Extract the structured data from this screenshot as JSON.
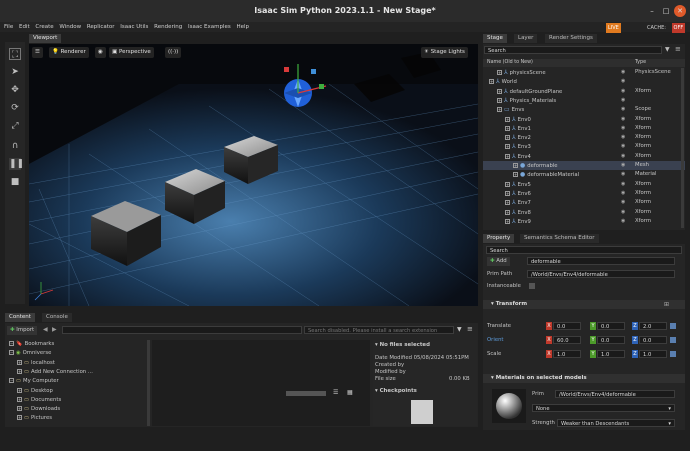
{
  "window": {
    "title": "Isaac Sim Python 2023.1.1 - New Stage*"
  },
  "menu": [
    "File",
    "Edit",
    "Create",
    "Window",
    "Replicator",
    "Isaac Utils",
    "Rendering",
    "Isaac Examples",
    "Help"
  ],
  "status": {
    "live": "LIVE",
    "cache_label": "CACHE:",
    "cache_state": "OFF"
  },
  "viewport": {
    "tab": "Viewport",
    "renderer": "Renderer",
    "camera": "Perspective",
    "stage_lights": "Stage Lights"
  },
  "stage": {
    "tabs": [
      "Stage",
      "Layer",
      "Render Settings"
    ],
    "search_placeholder": "Search",
    "col_name": "Name (Old to New)",
    "col_type": "Type",
    "rows": [
      {
        "name": "physicsScene",
        "type": "PhysicsScene",
        "indent": 1
      },
      {
        "name": "World",
        "type": "",
        "indent": 0
      },
      {
        "name": "defaultGroundPlane",
        "type": "Xform",
        "indent": 1
      },
      {
        "name": "Physics_Materials",
        "type": "",
        "indent": 1
      },
      {
        "name": "Envs",
        "type": "Scope",
        "indent": 1
      },
      {
        "name": "Env0",
        "type": "Xform",
        "indent": 2
      },
      {
        "name": "Env1",
        "type": "Xform",
        "indent": 2
      },
      {
        "name": "Env2",
        "type": "Xform",
        "indent": 2
      },
      {
        "name": "Env3",
        "type": "Xform",
        "indent": 2
      },
      {
        "name": "Env4",
        "type": "Xform",
        "indent": 2
      },
      {
        "name": "deformable",
        "type": "Mesh",
        "indent": 3
      },
      {
        "name": "deformableMaterial",
        "type": "Material",
        "indent": 3
      },
      {
        "name": "Env5",
        "type": "Xform",
        "indent": 2
      },
      {
        "name": "Env6",
        "type": "Xform",
        "indent": 2
      },
      {
        "name": "Env7",
        "type": "Xform",
        "indent": 2
      },
      {
        "name": "Env8",
        "type": "Xform",
        "indent": 2
      },
      {
        "name": "Env9",
        "type": "Xform",
        "indent": 2
      }
    ]
  },
  "property": {
    "tabs": [
      "Property",
      "Semantics Schema Editor"
    ],
    "search_placeholder": "Search",
    "add_label": "Add",
    "name_value": "deformable",
    "prim_path_label": "Prim Path",
    "prim_path_value": "/World/Envs/Env4/deformable",
    "instanceable_label": "Instanceable",
    "transform_title": "Transform",
    "translate_label": "Translate",
    "orient_label": "Orient",
    "scale_label": "Scale",
    "translate": [
      "0.0",
      "0.0",
      "2.0"
    ],
    "orient": [
      "60.0",
      "0.0",
      "0.0"
    ],
    "scale": [
      "1.0",
      "1.0",
      "1.0"
    ],
    "materials_title": "Materials on selected models",
    "prim_label": "Prim",
    "prim_value": "/World/Envs/Env4/deformable",
    "material_value": "None",
    "strength_label": "Strength",
    "strength_value": "Weaker than Descendants"
  },
  "content": {
    "tabs": [
      "Content",
      "Console"
    ],
    "import_label": "Import",
    "search_placeholder": "Search disabled. Please install a search extension",
    "tree": [
      {
        "name": "Bookmarks",
        "indent": 0
      },
      {
        "name": "Omniverse",
        "indent": 0
      },
      {
        "name": "localhost",
        "indent": 1
      },
      {
        "name": "Add New Connection ...",
        "indent": 1
      },
      {
        "name": "My Computer",
        "indent": 0
      },
      {
        "name": "Desktop",
        "indent": 1
      },
      {
        "name": "Documents",
        "indent": 1
      },
      {
        "name": "Downloads",
        "indent": 1
      },
      {
        "name": "Pictures",
        "indent": 1
      }
    ],
    "no_files": "No files selected",
    "date_modified": "Date Modified 05/08/2024 05:51PM",
    "created_by": "Created by",
    "modified_by": "Modified by",
    "file_size_label": "File size",
    "file_size_value": "0.00 KB",
    "checkpoints": "Checkpoints"
  },
  "colors": {
    "x_axis": "#c0392b",
    "y_axis": "#4c9a2a",
    "z_axis": "#2e63b8",
    "selected": "#3a4150"
  }
}
